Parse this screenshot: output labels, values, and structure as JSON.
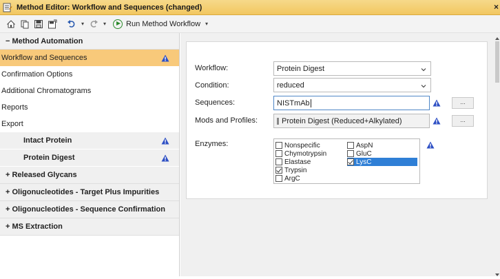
{
  "window": {
    "title": "Method Editor: Workflow and Sequences (changed)",
    "close_label": "×"
  },
  "toolbar": {
    "icons": [
      "home-icon",
      "open-icon",
      "save-icon",
      "save-as-icon",
      "undo-icon",
      "redo-icon"
    ],
    "run_label": "Run Method Workflow",
    "dropdown_glyph": "▾"
  },
  "sidebar": {
    "header": "− Method Automation",
    "items": [
      {
        "label": "Workflow and Sequences",
        "selected": true,
        "warning": true
      },
      {
        "label": "Confirmation Options"
      },
      {
        "label": "Additional Chromatograms"
      },
      {
        "label": "Reports"
      },
      {
        "label": "Export"
      }
    ],
    "subitems": [
      {
        "label": "Intact Protein",
        "warning": true
      },
      {
        "label": "Protein Digest",
        "warning": true
      }
    ],
    "groups": [
      "+ Released Glycans",
      "+ Oligonucleotides - Target Plus Impurities",
      "+ Oligonucleotides - Sequence Confirmation",
      "+ MS Extraction"
    ]
  },
  "form": {
    "workflow_label": "Workflow:",
    "workflow_value": "Protein Digest",
    "condition_label": "Condition:",
    "condition_value": "reduced",
    "sequences_label": "Sequences:",
    "sequences_value": "NISTmAb",
    "mods_label": "Mods and Profiles:",
    "mods_value": "Protein Digest (Reduced+Alkylated)",
    "enzymes_label": "Enzymes:",
    "browse_label": "...",
    "enzymes_left": [
      {
        "name": "Nonspecific",
        "checked": false
      },
      {
        "name": "Chymotrypsin",
        "checked": false
      },
      {
        "name": "Elastase",
        "checked": false
      },
      {
        "name": "Trypsin",
        "checked": true
      },
      {
        "name": "ArgC",
        "checked": false
      }
    ],
    "enzymes_right": [
      {
        "name": "AspN",
        "checked": false
      },
      {
        "name": "GluC",
        "checked": false
      },
      {
        "name": "LysC",
        "checked": true,
        "selected": true
      }
    ]
  },
  "colors": {
    "accent_selected": "#f8c97a",
    "warning_icon": "#2d4fc4",
    "selection_blue": "#2f7fd6"
  }
}
